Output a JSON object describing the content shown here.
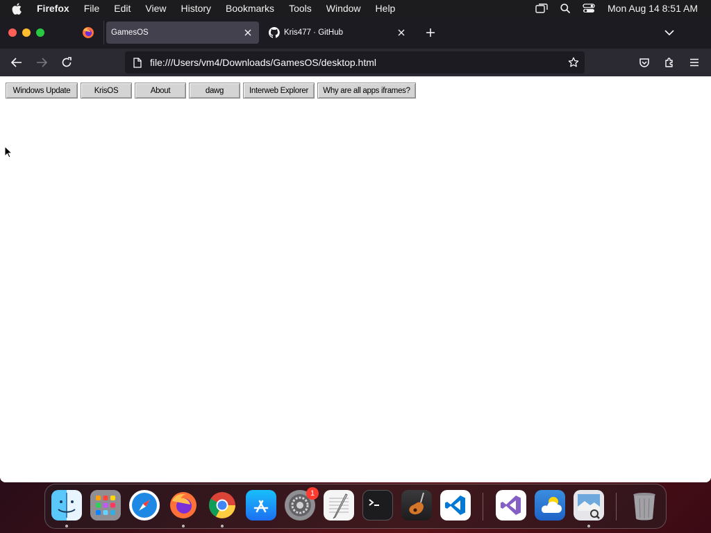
{
  "menubar": {
    "app_name": "Firefox",
    "items": [
      "File",
      "Edit",
      "View",
      "History",
      "Bookmarks",
      "Tools",
      "Window",
      "Help"
    ],
    "clock": "Mon Aug 14  8:51 AM"
  },
  "tabs": [
    {
      "title": "GamesOS",
      "active": true,
      "icon": "page"
    },
    {
      "title": "Kris477 · GitHub",
      "active": false,
      "icon": "github-icon"
    }
  ],
  "urlbar": {
    "url": "file:///Users/vm4/Downloads/GamesOS/desktop.html"
  },
  "page": {
    "buttons": [
      "Windows Update",
      "KrisOS",
      "About",
      "dawg",
      "Interweb Explorer",
      "Why are all apps iframes?"
    ]
  },
  "dock": {
    "apps": [
      "Finder",
      "Launchpad",
      "Safari",
      "Firefox",
      "Google Chrome",
      "App Store",
      "System Settings",
      "TextEdit",
      "Terminal",
      "GarageBand",
      "Visual Studio Code",
      "Visual Studio",
      "Weather",
      "Preview",
      "Trash"
    ],
    "settings_badge": "1"
  },
  "colors": {
    "tabbar_bg": "#1c1b22",
    "navbar_bg": "#2b2a33",
    "active_tab": "#42414d",
    "page_bg": "#ffffff",
    "button_face": "#d4d4d4"
  }
}
